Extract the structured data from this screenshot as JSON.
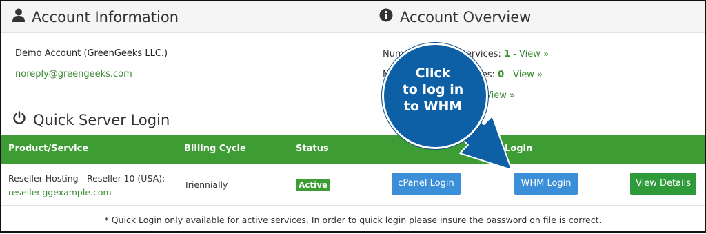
{
  "account_info": {
    "title": "Account Information",
    "name": "Demo Account (GreenGeeks LLC.)",
    "email": "noreply@greengeeks.com"
  },
  "account_overview": {
    "title": "Account Overview",
    "lines": [
      {
        "prefix": "Num",
        "suffix": "Services: ",
        "count": "1",
        "link": " - View »"
      },
      {
        "prefix": "N",
        "suffix": "Services: ",
        "count": "0",
        "link": " - View »"
      },
      {
        "link": "View »"
      }
    ]
  },
  "quick_login": {
    "title": "Quick Server Login",
    "headers": {
      "product": "Product/Service",
      "billing": "Billing Cycle",
      "status": "Status",
      "login": "Login"
    },
    "row": {
      "product": "Reseller Hosting - Reseller-10 (USA):",
      "domain": "reseller.ggexample.com",
      "billing": "Triennially",
      "status": "Active",
      "cpanel_button": "cPanel Login",
      "whm_button": "WHM Login",
      "details_button": "View Details"
    },
    "footnote": "* Quick Login only available for active services. In order to quick login please insure the password on file is correct."
  },
  "callout": {
    "line1": "Click",
    "line2": "to log in",
    "line3": "to WHM"
  },
  "colors": {
    "header_green": "#3d9c34",
    "link_green": "#3d8b35",
    "button_blue": "#3a8fd8",
    "callout_blue": "#0d5fa6"
  },
  "icons": {
    "account_info": "user-icon",
    "account_overview": "info-circle-icon",
    "quick_login": "power-icon"
  }
}
